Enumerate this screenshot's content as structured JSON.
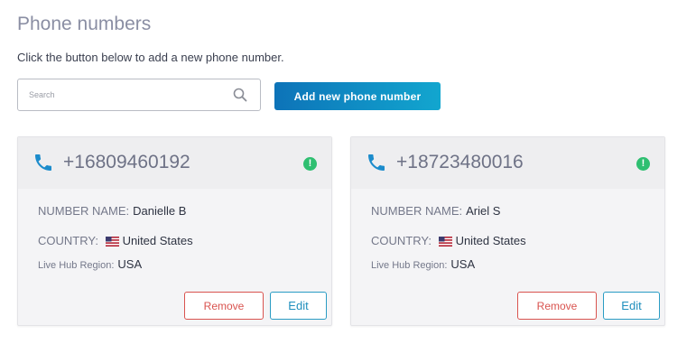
{
  "page": {
    "title": "Phone numbers",
    "subtitle": "Click the button below to add a new phone number."
  },
  "search": {
    "placeholder": "Search",
    "value": "",
    "icon": "search-icon"
  },
  "add_button_label": "Add new phone number",
  "cards": [
    {
      "number": "+16809460192",
      "status_glyph": "!",
      "status_color": "#2fbf71",
      "number_name_label": "NUMBER NAME:",
      "number_name": "Danielle B",
      "country_label": "COUNTRY:",
      "country": "United States",
      "region_label": "Live Hub Region:",
      "region": "USA",
      "remove_label": "Remove",
      "edit_label": "Edit"
    },
    {
      "number": "+18723480016",
      "status_glyph": "!",
      "status_color": "#2fbf71",
      "number_name_label": "NUMBER NAME:",
      "number_name": "Ariel S",
      "country_label": "COUNTRY:",
      "country": "United States",
      "region_label": "Live Hub Region:",
      "region": "USA",
      "remove_label": "Remove",
      "edit_label": "Edit"
    }
  ],
  "colors": {
    "accent": "#0d73b8",
    "accent_end": "#12a6cf",
    "danger": "#d9534f",
    "phone_icon": "#1c8ccc"
  }
}
